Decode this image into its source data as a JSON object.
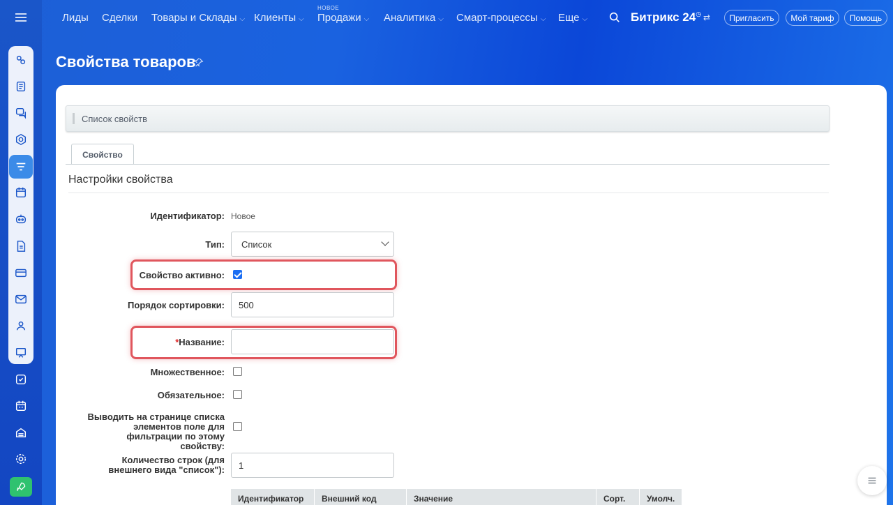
{
  "nav": {
    "items": [
      {
        "label": "Лиды",
        "chevron": false
      },
      {
        "label": "Сделки",
        "chevron": false
      },
      {
        "label": "Товары и Склады",
        "chevron": true
      },
      {
        "label": "Клиенты",
        "chevron": true
      },
      {
        "label": "Продажи",
        "chevron": true,
        "badge": "НОВОЕ"
      },
      {
        "label": "Аналитика",
        "chevron": true
      },
      {
        "label": "Смарт-процессы",
        "chevron": true
      },
      {
        "label": "Еще",
        "chevron": true
      }
    ],
    "brand": "Битрикс 24",
    "invite": "Пригласить",
    "tariff": "Мой тариф",
    "help": "Помощь"
  },
  "page": {
    "title": "Свойства товаров"
  },
  "card": {
    "list_link": "Список свойств",
    "tab": "Свойство",
    "section_title": "Настройки свойства"
  },
  "form": {
    "identifier_label": "Идентификатор:",
    "identifier_value": "Новое",
    "type_label": "Тип:",
    "type_value": "Список",
    "active_label": "Свойство активно:",
    "active_checked": true,
    "sort_label": "Порядок сортировки:",
    "sort_value": "500",
    "name_required_mark": "*",
    "name_label": "Название:",
    "name_value": "",
    "multiple_label": "Множественное:",
    "required_label": "Обязательное:",
    "filter_label": "Выводить на странице списка элементов поле для фильтрации по этому свойству:",
    "rows_label": "Количество строк (для внешнего вида \"список\"):",
    "rows_value": "1"
  },
  "values_table": {
    "columns": [
      "Идентификатор",
      "Внешний код",
      "Значение",
      "Сорт.",
      "Умолч."
    ]
  },
  "colors": {
    "accent": "#1b6ef3",
    "highlight": "#e0565d",
    "rocket": "#2fc26f"
  }
}
